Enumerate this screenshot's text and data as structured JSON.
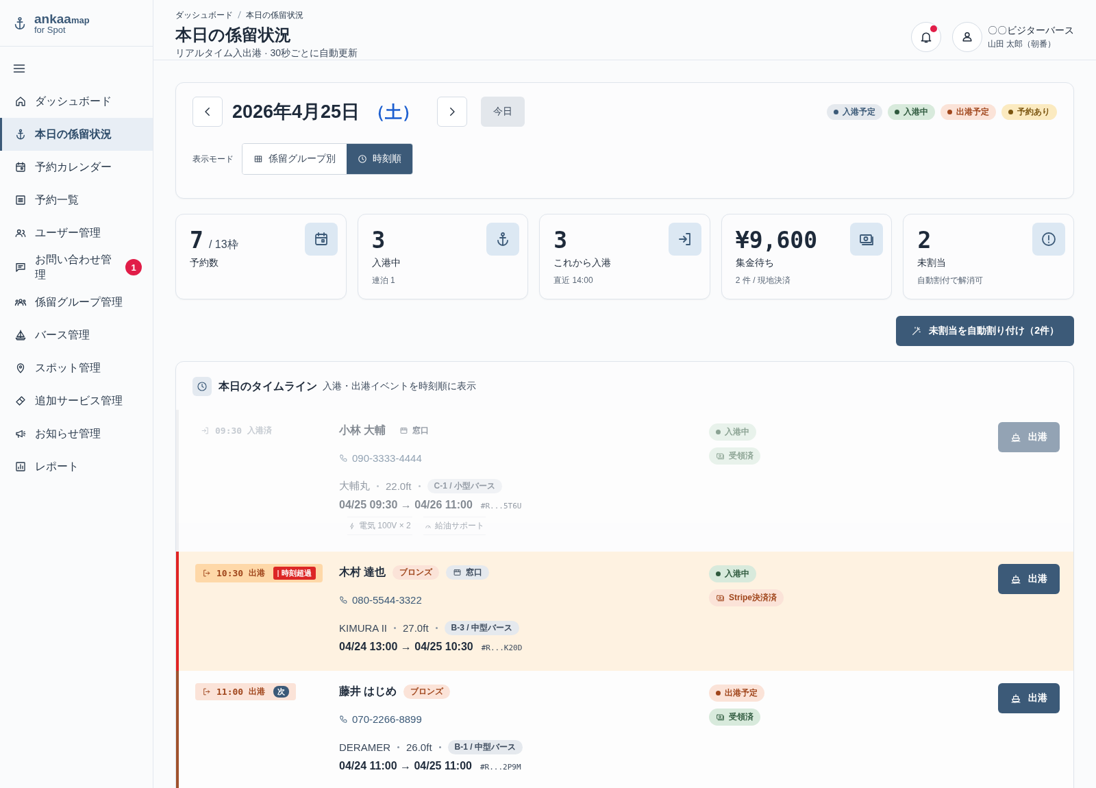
{
  "brand": {
    "name": "ankaa",
    "suffix": "map",
    "sub": "for Spot"
  },
  "sidebar": {
    "items": [
      {
        "label": "ダッシュボード",
        "selected": false
      },
      {
        "label": "本日の係留状況",
        "selected": true
      },
      {
        "label": "予約カレンダー",
        "selected": false
      },
      {
        "label": "予約一覧",
        "selected": false
      },
      {
        "label": "ユーザー管理",
        "selected": false
      },
      {
        "label": "お問い合わせ管理",
        "selected": false,
        "badge": "1"
      },
      {
        "label": "係留グループ管理",
        "selected": false
      },
      {
        "label": "バース管理",
        "selected": false
      },
      {
        "label": "スポット管理",
        "selected": false
      },
      {
        "label": "追加サービス管理",
        "selected": false
      },
      {
        "label": "お知らせ管理",
        "selected": false
      },
      {
        "label": "レポート",
        "selected": false
      }
    ]
  },
  "header": {
    "breadcrumb": [
      "ダッシュボード",
      "本日の係留状況"
    ],
    "title": "本日の係留状況",
    "subtitle": "リアルタイム入出港 · 30秒ごとに自動更新",
    "notification_unread": true,
    "user": {
      "org": "〇〇ビジターバース",
      "name": "山田 太郎（朝番）"
    }
  },
  "date_nav": {
    "date": "2026年4月25日",
    "weekday": "（土）",
    "today": "今日",
    "legend": [
      {
        "label": "入港予定",
        "kind": "scheduled"
      },
      {
        "label": "入港中",
        "kind": "berthed"
      },
      {
        "label": "出港予定",
        "kind": "departing"
      },
      {
        "label": "予約あり",
        "kind": "reserved"
      }
    ],
    "view_mode_label": "表示モード",
    "view_modes": [
      {
        "label": "係留グループ別",
        "selected": false
      },
      {
        "label": "時刻順",
        "selected": true
      }
    ]
  },
  "stats": [
    {
      "value": "7",
      "unit": "/ 13枠",
      "label": "予約数"
    },
    {
      "value": "3",
      "label": "入港中",
      "sub": "連泊 1"
    },
    {
      "value": "3",
      "label": "これから入港",
      "sub": "直近 14:00"
    },
    {
      "value": "¥9,600",
      "label": "集金待ち",
      "sub": "2 件 / 現地決済"
    },
    {
      "value": "2",
      "label": "未割当",
      "sub": "自動割付で解消可"
    }
  ],
  "auto_assign_button": "未割当を自動割り付け（2件）",
  "timeline": {
    "title": "本日のタイムライン",
    "description": "入港・出港イベントを時刻順に表示",
    "events": [
      {
        "kind": "arrived",
        "time": "09:30",
        "action": "入港済",
        "done": true,
        "overdue": false,
        "name": "小林 大輔",
        "tags": [
          {
            "text": "窓口",
            "kind": "counter"
          }
        ],
        "phone": "090-3333-4444",
        "boat": "大輔丸",
        "length": "22.0ft",
        "berth": "C-1 / 小型バース",
        "period": "04/25 09:30 → 04/26 11:00",
        "ref": "#R...5T6U",
        "services": [
          {
            "text": "電気 100V × 2",
            "kind": "power"
          },
          {
            "text": "給油サポート",
            "kind": "fuel"
          }
        ],
        "statuses": [
          {
            "text": "入港中",
            "kind": "berthed"
          },
          {
            "text": "受領済",
            "kind": "paid"
          }
        ],
        "button": "出港"
      },
      {
        "kind": "departure",
        "time": "10:30",
        "action": "出港",
        "flag": {
          "text": "時刻超過",
          "kind": "overdue"
        },
        "done": false,
        "overdue": true,
        "name": "木村 達也",
        "tags": [
          {
            "text": "ブロンズ",
            "kind": "rank"
          },
          {
            "text": "窓口",
            "kind": "counter"
          }
        ],
        "phone": "080-5544-3322",
        "boat": "KIMURA II",
        "length": "27.0ft",
        "berth": "B-3 / 中型バース",
        "period": "04/24 13:00 → 04/25 10:30",
        "ref": "#R...K20D",
        "statuses": [
          {
            "text": "入港中",
            "kind": "berthed"
          },
          {
            "text": "Stripe決済済",
            "kind": "stripe"
          }
        ],
        "button": "出港"
      },
      {
        "kind": "departure",
        "time": "11:00",
        "action": "出港",
        "flag": {
          "text": "次",
          "kind": "next"
        },
        "done": false,
        "overdue": false,
        "name": "藤井 はじめ",
        "tags": [
          {
            "text": "ブロンズ",
            "kind": "rank"
          }
        ],
        "phone": "070-2266-8899",
        "boat": "DERAMER",
        "length": "26.0ft",
        "berth": "B-1 / 中型バース",
        "period": "04/24 11:00 → 04/25 11:00",
        "ref": "#R...2P9M",
        "statuses": [
          {
            "text": "出港予定",
            "kind": "departing"
          },
          {
            "text": "受領済",
            "kind": "paid"
          }
        ],
        "button": "出港"
      }
    ]
  }
}
